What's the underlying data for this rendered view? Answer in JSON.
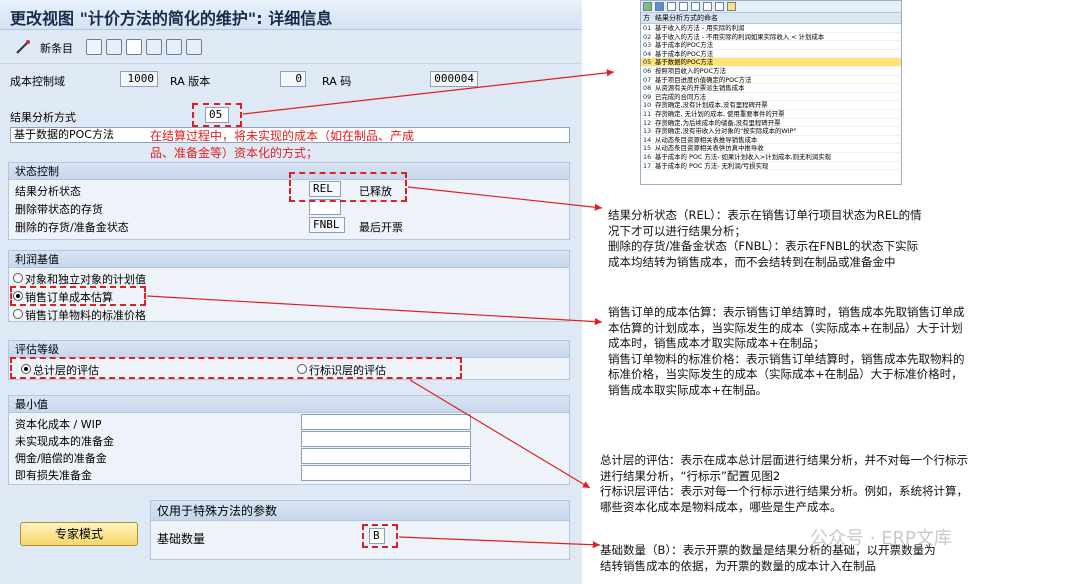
{
  "window_title": "更改视图 \"计价方法的简化的维护\": 详细信息",
  "toolbar": {
    "new_entries": "新条目"
  },
  "header_fields": {
    "controlling_area_label": "成本控制域",
    "controlling_area_value": "1000",
    "ra_version_label": "RA 版本",
    "ra_version_value": "0",
    "ra_key_label": "RA 码",
    "ra_key_value": "000004"
  },
  "ra_method": {
    "label": "结果分析方式",
    "value": "05",
    "description": "基于数据的POC方法"
  },
  "red_note": "在结算过程中，将未实现的成本（如在制品、产成品、准备金等）资本化的方式；",
  "status_control": {
    "title": "状态控制",
    "ra_status_label": "结果分析状态",
    "ra_status_value": "REL",
    "ra_status_text": "已释放",
    "deletion_with_status_label": "删除带状态的存货",
    "deletion_inventory_label": "删除的存货/准备金状态",
    "deletion_inventory_value": "FNBL",
    "deletion_inventory_text": "最后开票"
  },
  "profit_basis": {
    "title": "利润基值",
    "options": [
      "对象和独立对象的计划值",
      "销售订单成本估算",
      "销售订单物料的标准价格"
    ],
    "selected_index": 1
  },
  "valuation_level": {
    "title": "评估等级",
    "options": [
      "总计层的评估",
      "行标识层的评估"
    ],
    "selected_index": 0
  },
  "minimum_values": {
    "title": "最小值",
    "rows": [
      "资本化成本 / WIP",
      "未实现成本的准备金",
      "佣金/赔偿的准备金",
      "即有损失准备金"
    ]
  },
  "special_params": {
    "title": "仅用于特殊方法的参数",
    "basis_qty_label": "基础数量",
    "basis_qty_value": "B"
  },
  "expert_button": "专家模式",
  "method_list": {
    "col_code": "方",
    "col_name": "结果分析方式的命名",
    "selected_index": 4,
    "items": [
      {
        "code": "01",
        "name": "基于收入的方法 - 用实际的利润"
      },
      {
        "code": "02",
        "name": "基于收入的方法 - 不用实际的利润如果实际收入 < 计划成本"
      },
      {
        "code": "03",
        "name": "基于成本的POC方法"
      },
      {
        "code": "04",
        "name": "基于成本的POC方法"
      },
      {
        "code": "05",
        "name": "基于数据的POC方法"
      },
      {
        "code": "06",
        "name": "按照项目收入的POC方法"
      },
      {
        "code": "07",
        "name": "基于项目进度价值确定的POC方法"
      },
      {
        "code": "08",
        "name": "从资源有关的开票派生销售成本"
      },
      {
        "code": "09",
        "name": "已完成的合同方法"
      },
      {
        "code": "10",
        "name": "存货确定,没有计划成本,没有里程碑开票"
      },
      {
        "code": "11",
        "name": "存货确定, 无计划的成本, 使用重要事件的开票"
      },
      {
        "code": "12",
        "name": "存货确定,为后续成本的储备,没有里程碑开票"
      },
      {
        "code": "13",
        "name": "存货确定,没有带收入分对象的\"按实际成本的WIP\""
      },
      {
        "code": "14",
        "name": "从动态条目资源相关表推导销售成本"
      },
      {
        "code": "15",
        "name": "从动态条目资源相关表供仿真中推导收"
      },
      {
        "code": "16",
        "name": "基于成本的 POC 方法- 如果计划收入>计划成本,则无利润实现"
      },
      {
        "code": "17",
        "name": "基于成本的 POC 方法- 无利润/亏损实现"
      }
    ]
  },
  "annotations": {
    "status": [
      "结果分析状态（REL）：表示在销售订单行项目状态为REL的情",
      "况下才可以进行结果分析；",
      "删除的存货/准备金状态（FNBL）：表示在FNBL的状态下实际",
      "成本均结转为销售成本，而不会结转到在制品或准备金中"
    ],
    "profit": [
      "销售订单的成本估算：表示销售订单结算时，销售成本先取销售订单成",
      "本估算的计划成本，当实际发生的成本（实际成本+在制品）大于计划",
      "成本时，销售成本才取实际成本+在制品；",
      "销售订单物料的标准价格：表示销售订单结算时，销售成本先取物料的",
      "标准价格，当实际发生的成本（实际成本+在制品）大于标准价格时，",
      "销售成本取实际成本+在制品。"
    ],
    "valuation": [
      "总计层的评估：表示在成本总计层面进行结果分析，并不对每一个行标示",
      "进行结果分析，“行标示”配置见图2",
      "行标识层评估：表示对每一个行标示进行结果分析。例如，系统将计算，",
      "哪些资本化成本是物料成本，哪些是生产成本。"
    ],
    "basis": [
      "基础数量（B）：表示开票的数量是结果分析的基础，以开票数量为",
      "结转销售成本的依据，为开票的数量的成本计入在制品"
    ]
  },
  "watermark": "公众号 · ERP文库"
}
